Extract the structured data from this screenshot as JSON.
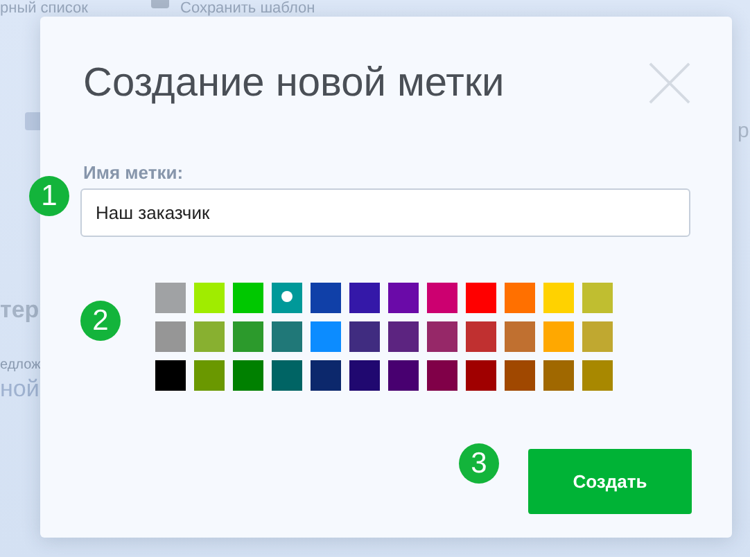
{
  "background": {
    "texts": [
      {
        "kind": "top",
        "text": "рный список"
      },
      {
        "kind": "save",
        "text": "Сохранить шаблон"
      },
      {
        "kind": "heading",
        "text": "тер"
      },
      {
        "kind": "small",
        "text": "едлож"
      },
      {
        "kind": "body",
        "text": "ной"
      },
      {
        "kind": "right",
        "text": "р"
      }
    ]
  },
  "dialog": {
    "title": "Создание новой метки",
    "field": {
      "label": "Имя метки:",
      "value": "Наш заказчик"
    },
    "swatches": [
      [
        {
          "color": "#a0a2a4",
          "selected": false
        },
        {
          "color": "#a0ec00",
          "selected": false
        },
        {
          "color": "#00c800",
          "selected": false
        },
        {
          "color": "#009999",
          "selected": true
        },
        {
          "color": "#1040a8",
          "selected": false
        },
        {
          "color": "#3418a8",
          "selected": false
        },
        {
          "color": "#6a0aa8",
          "selected": false
        },
        {
          "color": "#cc0070",
          "selected": false
        },
        {
          "color": "#ff0000",
          "selected": false
        },
        {
          "color": "#ff7000",
          "selected": false
        },
        {
          "color": "#ffd200",
          "selected": false
        },
        {
          "color": "#c0be30",
          "selected": false
        }
      ],
      [
        {
          "color": "#969696",
          "selected": false
        },
        {
          "color": "#88b030",
          "selected": false
        },
        {
          "color": "#2c9a2c",
          "selected": false
        },
        {
          "color": "#207878",
          "selected": false
        },
        {
          "color": "#0c8cff",
          "selected": false
        },
        {
          "color": "#402c80",
          "selected": false
        },
        {
          "color": "#5c2480",
          "selected": false
        },
        {
          "color": "#962868",
          "selected": false
        },
        {
          "color": "#c03030",
          "selected": false
        },
        {
          "color": "#c07030",
          "selected": false
        },
        {
          "color": "#ffa800",
          "selected": false
        },
        {
          "color": "#c0a830",
          "selected": false
        }
      ],
      [
        {
          "color": "#000000",
          "selected": false
        },
        {
          "color": "#6a9800",
          "selected": false
        },
        {
          "color": "#008000",
          "selected": false
        },
        {
          "color": "#006464",
          "selected": false
        },
        {
          "color": "#0c286c",
          "selected": false
        },
        {
          "color": "#200870",
          "selected": false
        },
        {
          "color": "#480070",
          "selected": false
        },
        {
          "color": "#800048",
          "selected": false
        },
        {
          "color": "#a00000",
          "selected": false
        },
        {
          "color": "#a04800",
          "selected": false
        },
        {
          "color": "#a06800",
          "selected": false
        },
        {
          "color": "#a88800",
          "selected": false
        }
      ]
    ],
    "button": "Создать"
  },
  "markers": [
    {
      "kind": "field",
      "text": "1"
    },
    {
      "kind": "swatches",
      "text": "2"
    },
    {
      "kind": "button",
      "text": "3"
    }
  ]
}
